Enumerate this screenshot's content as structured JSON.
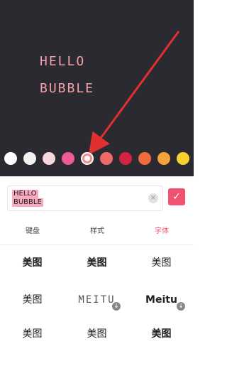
{
  "canvas": {
    "line1": "HELLO",
    "line2": "BUBBLE",
    "text_color": "#f0a0a8",
    "background": "#2b2a30",
    "arrow_color": "#e03030"
  },
  "swatches": [
    {
      "color": "#ffffff",
      "selected": false
    },
    {
      "color": "#f2f2f2",
      "selected": false
    },
    {
      "color": "#f7d7de",
      "selected": false
    },
    {
      "color": "#ee5b96",
      "selected": false
    },
    {
      "color": "#ef8b8e",
      "selected": true
    },
    {
      "color": "#f06a6a",
      "selected": false
    },
    {
      "color": "#d12443",
      "selected": false
    },
    {
      "color": "#f06b3c",
      "selected": false
    },
    {
      "color": "#f6a23a",
      "selected": false
    },
    {
      "color": "#f8d12f",
      "selected": false
    }
  ],
  "input": {
    "value_line1": "HELLO",
    "value_line2": "BUBBLE",
    "clear_icon": "×",
    "confirm_icon": "✓"
  },
  "tabs": [
    {
      "label": "键盘",
      "active": false
    },
    {
      "label": "样式",
      "active": false
    },
    {
      "label": "字体",
      "active": true
    }
  ],
  "font_grid": [
    [
      "美图",
      "美图",
      "美图"
    ],
    [
      "美图",
      "MEITU",
      "Meitu"
    ],
    [
      "美图",
      "美图",
      "美图"
    ]
  ],
  "download_icon": "↓"
}
